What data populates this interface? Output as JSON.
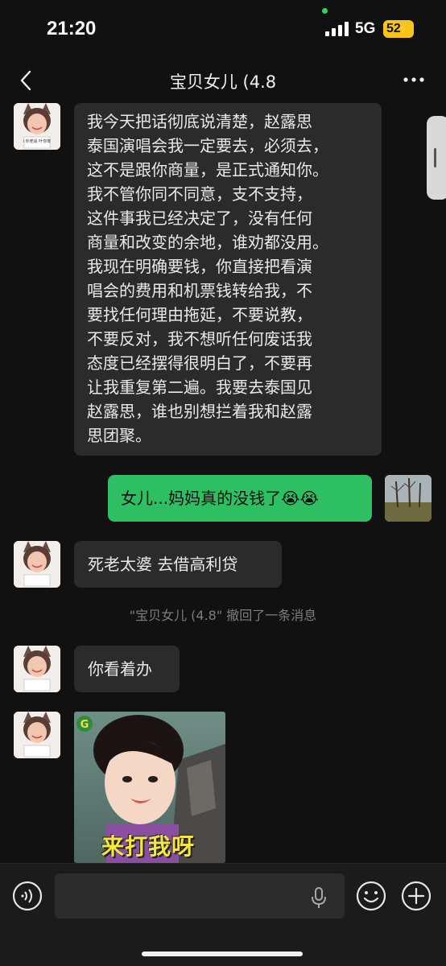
{
  "status_bar": {
    "time": "21:20",
    "network": "5G",
    "battery": "52"
  },
  "nav": {
    "back_icon": "chevron-left-icon",
    "title": "宝贝女儿 (4.8",
    "more_icon": "more-dots-icon"
  },
  "messages": [
    {
      "from": "contact",
      "lines": [
        "我今天把话彻底说清楚，赵露思",
        "泰国演唱会我一定要去，必须去，",
        "这不是跟你商量，是正式通知你。",
        "我不管你同不同意，支不支持，",
        "这件事我已经决定了，没有任何",
        "商量和改变的余地，谁劝都没用。",
        "我现在明确要钱，你直接把看演",
        "唱会的费用和机票钱转给我，不",
        "要找任何理由拖延，不要说教，",
        "不要反对，我不想听任何废话我",
        "态度已经摆得很明白了，不要再",
        "让我重复第二遍。我要去泰国见",
        "赵露思，谁也别想拦着我和赵露",
        "思团聚。"
      ]
    },
    {
      "from": "me",
      "text": "女儿...妈妈真的没钱了",
      "emoji": "😭😭"
    },
    {
      "from": "contact",
      "text": "死老太婆 去借高利贷"
    },
    {
      "from": "contact",
      "text": "你看着办"
    },
    {
      "from": "contact",
      "type": "sticker",
      "caption": "来打我呀",
      "badge": "G"
    }
  ],
  "recall_notice": "\"宝贝女儿 (4.8\" 撤回了一条消息",
  "avatar_caption": "i 你老逼 叶你筹",
  "input_bar": {
    "voice_icon": "voice-input-icon",
    "mic_icon": "microphone-icon",
    "emoji_icon": "emoji-icon",
    "plus_icon": "plus-icon"
  },
  "colors": {
    "background": "#111111",
    "incoming_bubble": "#2b2b2b",
    "outgoing_bubble": "#2fbf63",
    "battery": "#f5c518"
  }
}
